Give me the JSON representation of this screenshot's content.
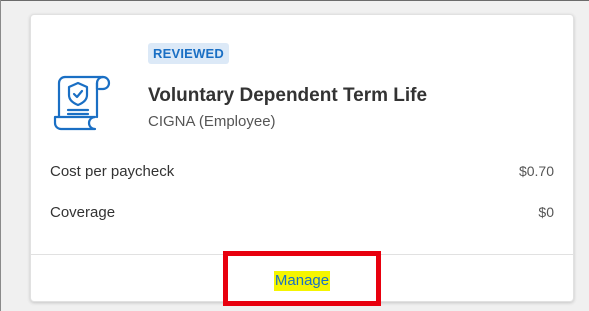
{
  "benefit_card": {
    "status_badge": "REVIEWED",
    "plan_name": "Voluntary Dependent Term Life",
    "carrier": "CIGNA (Employee)",
    "icon": "policy-document-shield-icon",
    "rows": [
      {
        "label": "Cost per paycheck",
        "value": "$0.70"
      },
      {
        "label": "Coverage",
        "value": "$0"
      }
    ],
    "action_label": "Manage"
  },
  "colors": {
    "accent": "#1a6fc4",
    "badge_background": "#dce9f7",
    "annotation_box": "#e8000e",
    "text_highlight": "#f5f500"
  }
}
